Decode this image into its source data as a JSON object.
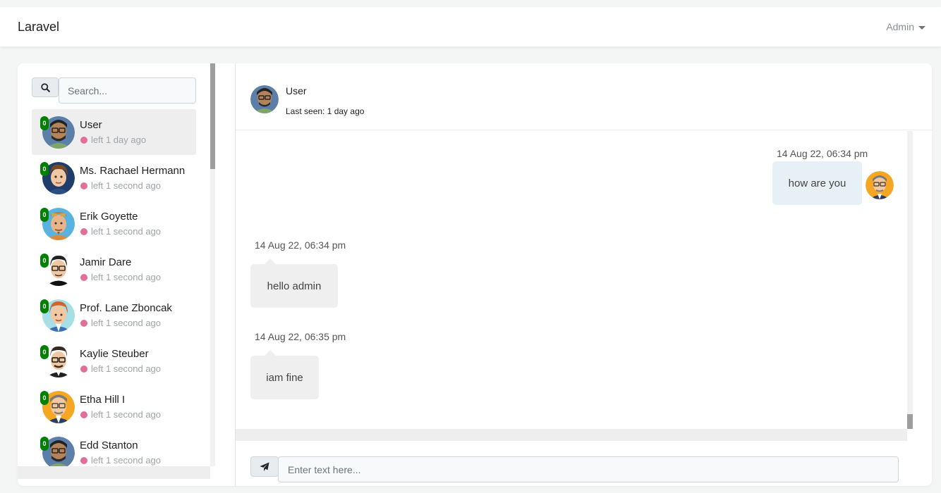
{
  "navbar": {
    "brand": "Laravel",
    "user_menu": "Admin"
  },
  "sidebar": {
    "search_placeholder": "Search...",
    "contacts": [
      {
        "name": "User",
        "status": "left 1 day ago",
        "unread": "0",
        "active": true,
        "avatar": "avatar-man-glasses-beard"
      },
      {
        "name": "Ms. Rachael Hermann",
        "status": "left 1 second ago",
        "unread": "0",
        "active": false,
        "avatar": "avatar-man-brown-hair"
      },
      {
        "name": "Erik Goyette",
        "status": "left 1 second ago",
        "unread": "0",
        "active": false,
        "avatar": "avatar-man-sunglasses-head"
      },
      {
        "name": "Jamir Dare",
        "status": "left 1 second ago",
        "unread": "0",
        "active": false,
        "avatar": "avatar-man-glasses-black"
      },
      {
        "name": "Prof. Lane Zboncak",
        "status": "left 1 second ago",
        "unread": "0",
        "active": false,
        "avatar": "avatar-man-ginger"
      },
      {
        "name": "Kaylie Steuber",
        "status": "left 1 second ago",
        "unread": "0",
        "active": false,
        "avatar": "avatar-man-glasses-dark-hair"
      },
      {
        "name": "Etha Hill I",
        "status": "left 1 second ago",
        "unread": "0",
        "active": false,
        "avatar": "avatar-man-grey-hair-glasses"
      },
      {
        "name": "Edd Stanton",
        "status": "left 1 second ago",
        "unread": "0",
        "active": false,
        "avatar": "avatar-man-glasses-beard"
      }
    ]
  },
  "chat": {
    "header": {
      "name": "User",
      "last_seen": "Last seen: 1 day ago"
    },
    "messages": [
      {
        "direction": "outgoing",
        "time": "14 Aug 22, 06:34 pm",
        "text": "how are you"
      },
      {
        "direction": "incoming",
        "time": "14 Aug 22, 06:34 pm",
        "text": "hello admin"
      },
      {
        "direction": "incoming",
        "time": "14 Aug 22, 06:35 pm",
        "text": "iam fine"
      }
    ],
    "input_placeholder": "Enter text here..."
  },
  "colors": {
    "online_badge": "#008000",
    "status_dot": "#e0709a",
    "outgoing_bubble": "#e6f0f5",
    "incoming_bubble": "#efefef"
  }
}
